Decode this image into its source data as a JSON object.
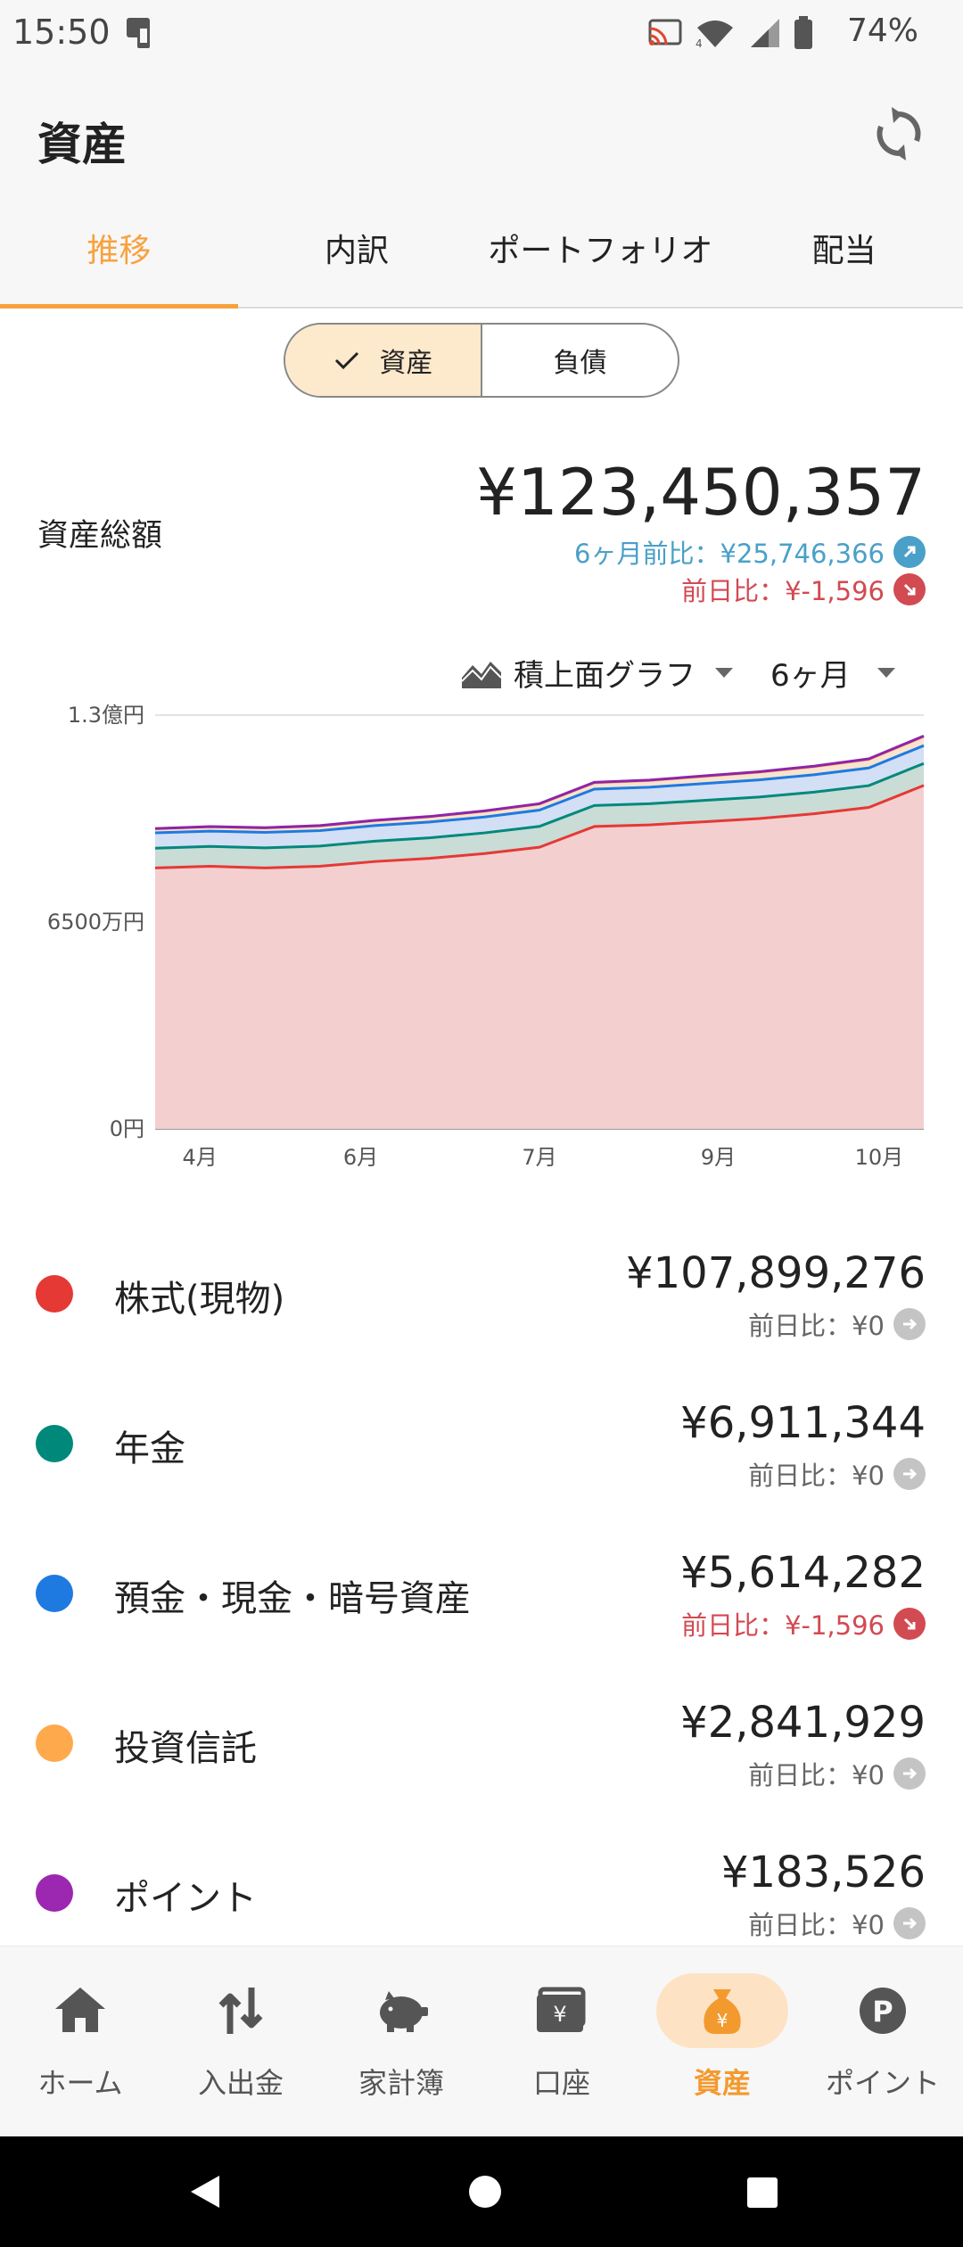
{
  "status_bar": {
    "time": "15:50",
    "battery": "74%"
  },
  "header": {
    "title": "資産"
  },
  "tabs": [
    {
      "label": "推移",
      "active": true
    },
    {
      "label": "内訳",
      "active": false
    },
    {
      "label": "ポートフォリオ",
      "active": false
    },
    {
      "label": "配当",
      "active": false
    }
  ],
  "segment": {
    "assets": "資産",
    "liabilities": "負債"
  },
  "summary": {
    "label": "資産総額",
    "total": "¥123,450,357",
    "six_month_compare": "6ヶ月前比：¥25,746,366",
    "day_compare": "前日比：¥-1,596"
  },
  "chart_controls": {
    "type": "積上面グラフ",
    "period": "6ヶ月"
  },
  "chart_data": {
    "type": "area",
    "stacked": true,
    "x_labels": [
      "4月",
      "6月",
      "7月",
      "9月",
      "10月"
    ],
    "y_ticks": [
      "1.3億円",
      "6500万円",
      "0円"
    ],
    "ylim": [
      0,
      130000000
    ],
    "grid": true,
    "x": [
      0,
      0.5,
      1,
      1.5,
      2,
      2.5,
      3,
      3.5,
      4,
      4.5,
      5,
      5.5,
      6,
      6.5,
      7
    ],
    "series": [
      {
        "name": "株式(現物)",
        "color": "#e53935",
        "fill": "#f4cfcf",
        "values": [
          82000000,
          82500000,
          82000000,
          82500000,
          84000000,
          85000000,
          86500000,
          88500000,
          95000000,
          95500000,
          96500000,
          97500000,
          99000000,
          101000000,
          107899276
        ]
      },
      {
        "name": "年金",
        "color": "#00897b",
        "fill": "#c9dcd6",
        "values": [
          6200000,
          6250000,
          6300000,
          6350000,
          6400000,
          6450000,
          6500000,
          6550000,
          6600000,
          6650000,
          6700000,
          6750000,
          6800000,
          6850000,
          6911344
        ]
      },
      {
        "name": "預金・現金・暗号資産",
        "color": "#1e7ae0",
        "fill": "#d3dff5",
        "values": [
          4800000,
          4800000,
          4850000,
          4850000,
          4900000,
          4950000,
          5000000,
          5100000,
          5150000,
          5200000,
          5300000,
          5400000,
          5450000,
          5550000,
          5614282
        ]
      },
      {
        "name": "投資信託",
        "color": "#ffa94d",
        "fill": "#f7e3cf",
        "values": [
          1300000,
          1350000,
          1400000,
          1500000,
          1550000,
          1650000,
          1800000,
          1900000,
          2000000,
          2100000,
          2250000,
          2400000,
          2550000,
          2700000,
          2841929
        ]
      },
      {
        "name": "ポイント",
        "color": "#8e24aa",
        "fill": "#e9d3ef",
        "values": [
          60000,
          65000,
          70000,
          80000,
          90000,
          100000,
          110000,
          120000,
          130000,
          140000,
          150000,
          160000,
          170000,
          178000,
          183526
        ]
      }
    ]
  },
  "assets": [
    {
      "name": "株式(現物)",
      "value": "¥107,899,276",
      "compare": "前日比：¥0",
      "trend": "flat",
      "color": "#e53935"
    },
    {
      "name": "年金",
      "value": "¥6,911,344",
      "compare": "前日比：¥0",
      "trend": "flat",
      "color": "#00897b"
    },
    {
      "name": "預金・現金・暗号資産",
      "value": "¥5,614,282",
      "compare": "前日比：¥-1,596",
      "trend": "down",
      "color": "#1e7ae0"
    },
    {
      "name": "投資信託",
      "value": "¥2,841,929",
      "compare": "前日比：¥0",
      "trend": "flat",
      "color": "#ffa94d"
    },
    {
      "name": "ポイント",
      "value": "¥183,526",
      "compare": "前日比：¥0",
      "trend": "flat",
      "color": "#9c27b0"
    }
  ],
  "bottom_nav": [
    {
      "label": "ホーム",
      "icon": "home-icon"
    },
    {
      "label": "入出金",
      "icon": "transfer-icon"
    },
    {
      "label": "家計簿",
      "icon": "piggy-bank-icon"
    },
    {
      "label": "口座",
      "icon": "wallet-icon"
    },
    {
      "label": "資産",
      "icon": "money-bag-icon",
      "active": true
    },
    {
      "label": "ポイント",
      "icon": "point-icon"
    }
  ],
  "colors": {
    "accent": "#f7a23e",
    "up": "#4aa0c8",
    "down": "#d24a52"
  }
}
